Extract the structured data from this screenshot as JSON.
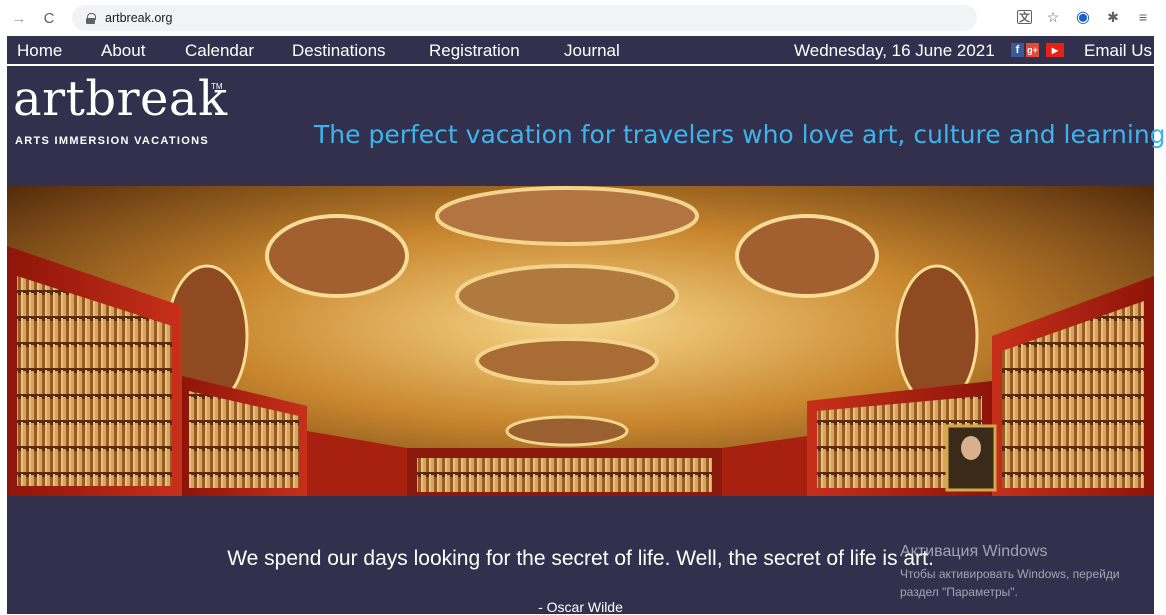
{
  "browser": {
    "url": "artbreak.org",
    "icons": [
      "back-arrow-icon",
      "reload-icon",
      "lock-icon",
      "translate-icon",
      "star-icon",
      "vpn-icon",
      "extensions-icon",
      "menu-icon"
    ]
  },
  "nav": {
    "items": [
      "Home",
      "About",
      "Calendar",
      "Destinations",
      "Registration",
      "Journal"
    ],
    "date": "Wednesday, 16 June 2021",
    "email_label": "Email Us"
  },
  "social": {
    "facebook": "f",
    "googleplus": "g+",
    "youtube": "▶"
  },
  "logo": {
    "word": "artbreak",
    "tm": "TM",
    "subtitle": "ARTS IMMERSION VACATIONS"
  },
  "tagline": "The perfect vacation for travelers who love art, culture and learning",
  "quote": {
    "text": "We spend our days looking for the secret of life. Well, the secret of life is art.",
    "author": "- Oscar Wilde"
  },
  "watermark": {
    "title": "Активация Windows",
    "line1": "Чтобы активировать Windows, перейди",
    "line2": "раздел \"Параметры\"."
  },
  "colors": {
    "site_bg": "#33304e",
    "tagline": "#3db4ec",
    "shelf_red": "#b4200f"
  }
}
